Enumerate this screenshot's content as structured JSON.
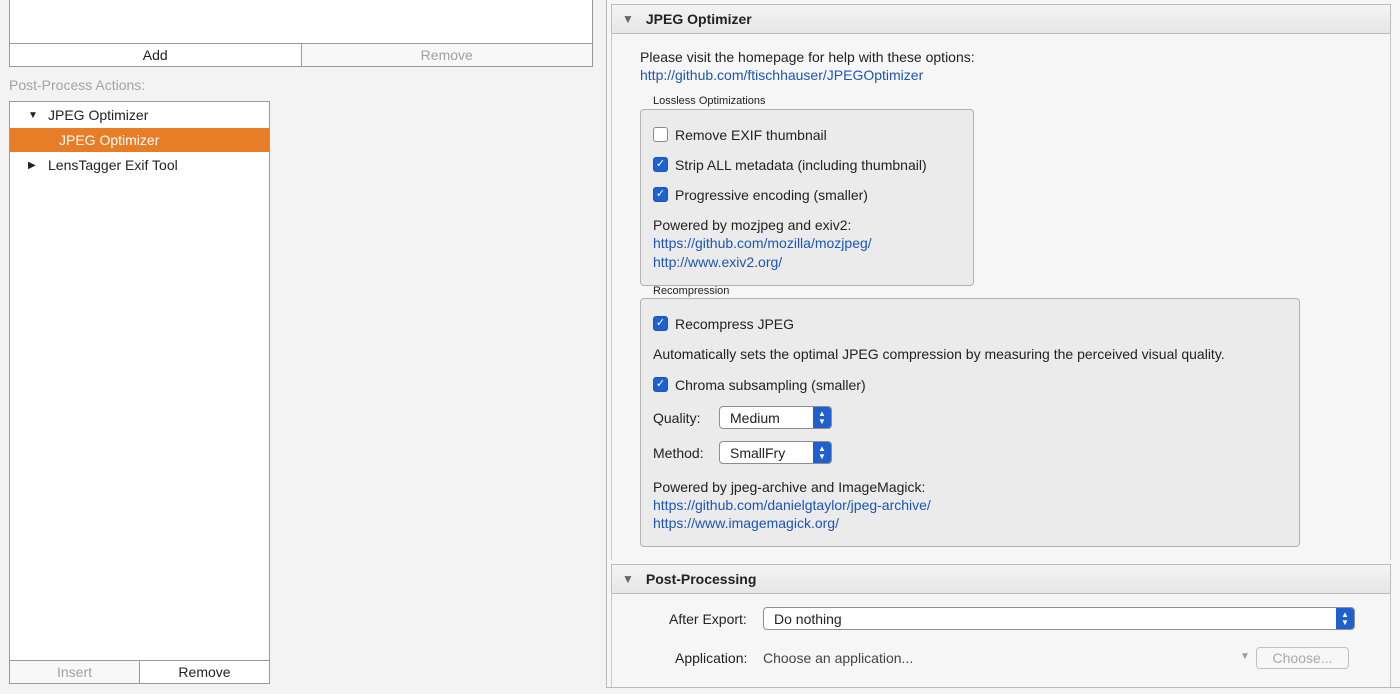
{
  "left": {
    "add_label": "Add",
    "remove_top_label": "Remove",
    "post_process_label": "Post-Process Actions:",
    "tree": [
      {
        "label": "JPEG Optimizer",
        "expanded": true
      },
      {
        "label": "JPEG Optimizer",
        "selected": true
      },
      {
        "label": "LensTagger Exif Tool",
        "expanded": false
      }
    ],
    "insert_label": "Insert",
    "remove_bottom_label": "Remove"
  },
  "jpeg": {
    "header": "JPEG Optimizer",
    "help_text": "Please visit the homepage for help with these options:",
    "help_link": "http://github.com/ftischhauser/JPEGOptimizer",
    "lossless": {
      "title": "Lossless Optimizations",
      "remove_exif": {
        "label": "Remove EXIF thumbnail",
        "checked": false
      },
      "strip_metadata": {
        "label": "Strip ALL metadata (including thumbnail)",
        "checked": true
      },
      "progressive": {
        "label": "Progressive encoding (smaller)",
        "checked": true
      },
      "powered_by": "Powered by mozjpeg and exiv2:",
      "link1": "https://github.com/mozilla/mozjpeg/",
      "link2": "http://www.exiv2.org/"
    },
    "recompression": {
      "title": "Recompression",
      "recompress": {
        "label": "Recompress JPEG",
        "checked": true
      },
      "description": "Automatically sets the optimal JPEG compression by measuring the perceived visual quality.",
      "chroma": {
        "label": "Chroma subsampling (smaller)",
        "checked": true
      },
      "quality_label": "Quality:",
      "quality_value": "Medium",
      "method_label": "Method:",
      "method_value": "SmallFry",
      "powered_by": "Powered by jpeg-archive and ImageMagick:",
      "link1": "https://github.com/danielgtaylor/jpeg-archive/",
      "link2": "https://www.imagemagick.org/"
    }
  },
  "post": {
    "header": "Post-Processing",
    "after_export_label": "After Export:",
    "after_export_value": "Do nothing",
    "application_label": "Application:",
    "application_placeholder": "Choose an application...",
    "choose_label": "Choose..."
  },
  "colors": {
    "accent_selected": "#e77d27",
    "checkbox_blue": "#1d61d0",
    "link": "#1b55b8"
  }
}
